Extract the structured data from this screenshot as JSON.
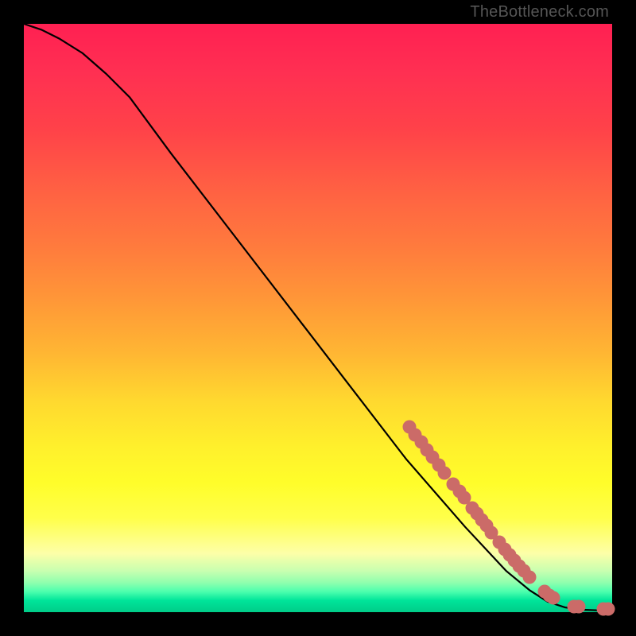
{
  "watermark": "TheBottleneck.com",
  "colors": {
    "dot": "#cb6b68",
    "curve": "#000000",
    "bg_black": "#000000"
  },
  "chart_data": {
    "type": "line",
    "title": "",
    "xlabel": "",
    "ylabel": "",
    "xlim": [
      0,
      100
    ],
    "ylim": [
      0,
      100
    ],
    "curve": [
      {
        "x": 0,
        "y": 100
      },
      {
        "x": 3,
        "y": 99
      },
      {
        "x": 6,
        "y": 97.5
      },
      {
        "x": 10,
        "y": 95
      },
      {
        "x": 14,
        "y": 91.5
      },
      {
        "x": 18,
        "y": 87.5
      },
      {
        "x": 25,
        "y": 78
      },
      {
        "x": 35,
        "y": 65
      },
      {
        "x": 45,
        "y": 52
      },
      {
        "x": 55,
        "y": 39
      },
      {
        "x": 65,
        "y": 26
      },
      {
        "x": 75,
        "y": 14.5
      },
      {
        "x": 82,
        "y": 7
      },
      {
        "x": 86,
        "y": 3.7
      },
      {
        "x": 89,
        "y": 1.8
      },
      {
        "x": 92,
        "y": 0.8
      },
      {
        "x": 95,
        "y": 0.4
      },
      {
        "x": 98,
        "y": 0.3
      },
      {
        "x": 100,
        "y": 0.3
      }
    ],
    "dots": [
      {
        "x": 65.5,
        "y": 31.5
      },
      {
        "x": 66.5,
        "y": 30.2
      },
      {
        "x": 67.5,
        "y": 28.9
      },
      {
        "x": 68.5,
        "y": 27.6
      },
      {
        "x": 69.5,
        "y": 26.3
      },
      {
        "x": 70.5,
        "y": 25.0
      },
      {
        "x": 71.5,
        "y": 23.7
      },
      {
        "x": 73.0,
        "y": 21.8
      },
      {
        "x": 74.0,
        "y": 20.5
      },
      {
        "x": 74.8,
        "y": 19.5
      },
      {
        "x": 76.2,
        "y": 17.7
      },
      {
        "x": 77.0,
        "y": 16.7
      },
      {
        "x": 77.8,
        "y": 15.7
      },
      {
        "x": 78.6,
        "y": 14.7
      },
      {
        "x": 79.5,
        "y": 13.5
      },
      {
        "x": 80.8,
        "y": 11.9
      },
      {
        "x": 81.8,
        "y": 10.7
      },
      {
        "x": 82.6,
        "y": 9.7
      },
      {
        "x": 83.4,
        "y": 8.8
      },
      {
        "x": 84.2,
        "y": 7.9
      },
      {
        "x": 85.0,
        "y": 7.0
      },
      {
        "x": 86.0,
        "y": 5.9
      },
      {
        "x": 88.5,
        "y": 3.5
      },
      {
        "x": 89.3,
        "y": 2.9
      },
      {
        "x": 90.0,
        "y": 2.4
      },
      {
        "x": 93.5,
        "y": 1.0
      },
      {
        "x": 94.3,
        "y": 0.9
      },
      {
        "x": 98.5,
        "y": 0.5
      },
      {
        "x": 99.3,
        "y": 0.5
      }
    ],
    "annotations": []
  }
}
